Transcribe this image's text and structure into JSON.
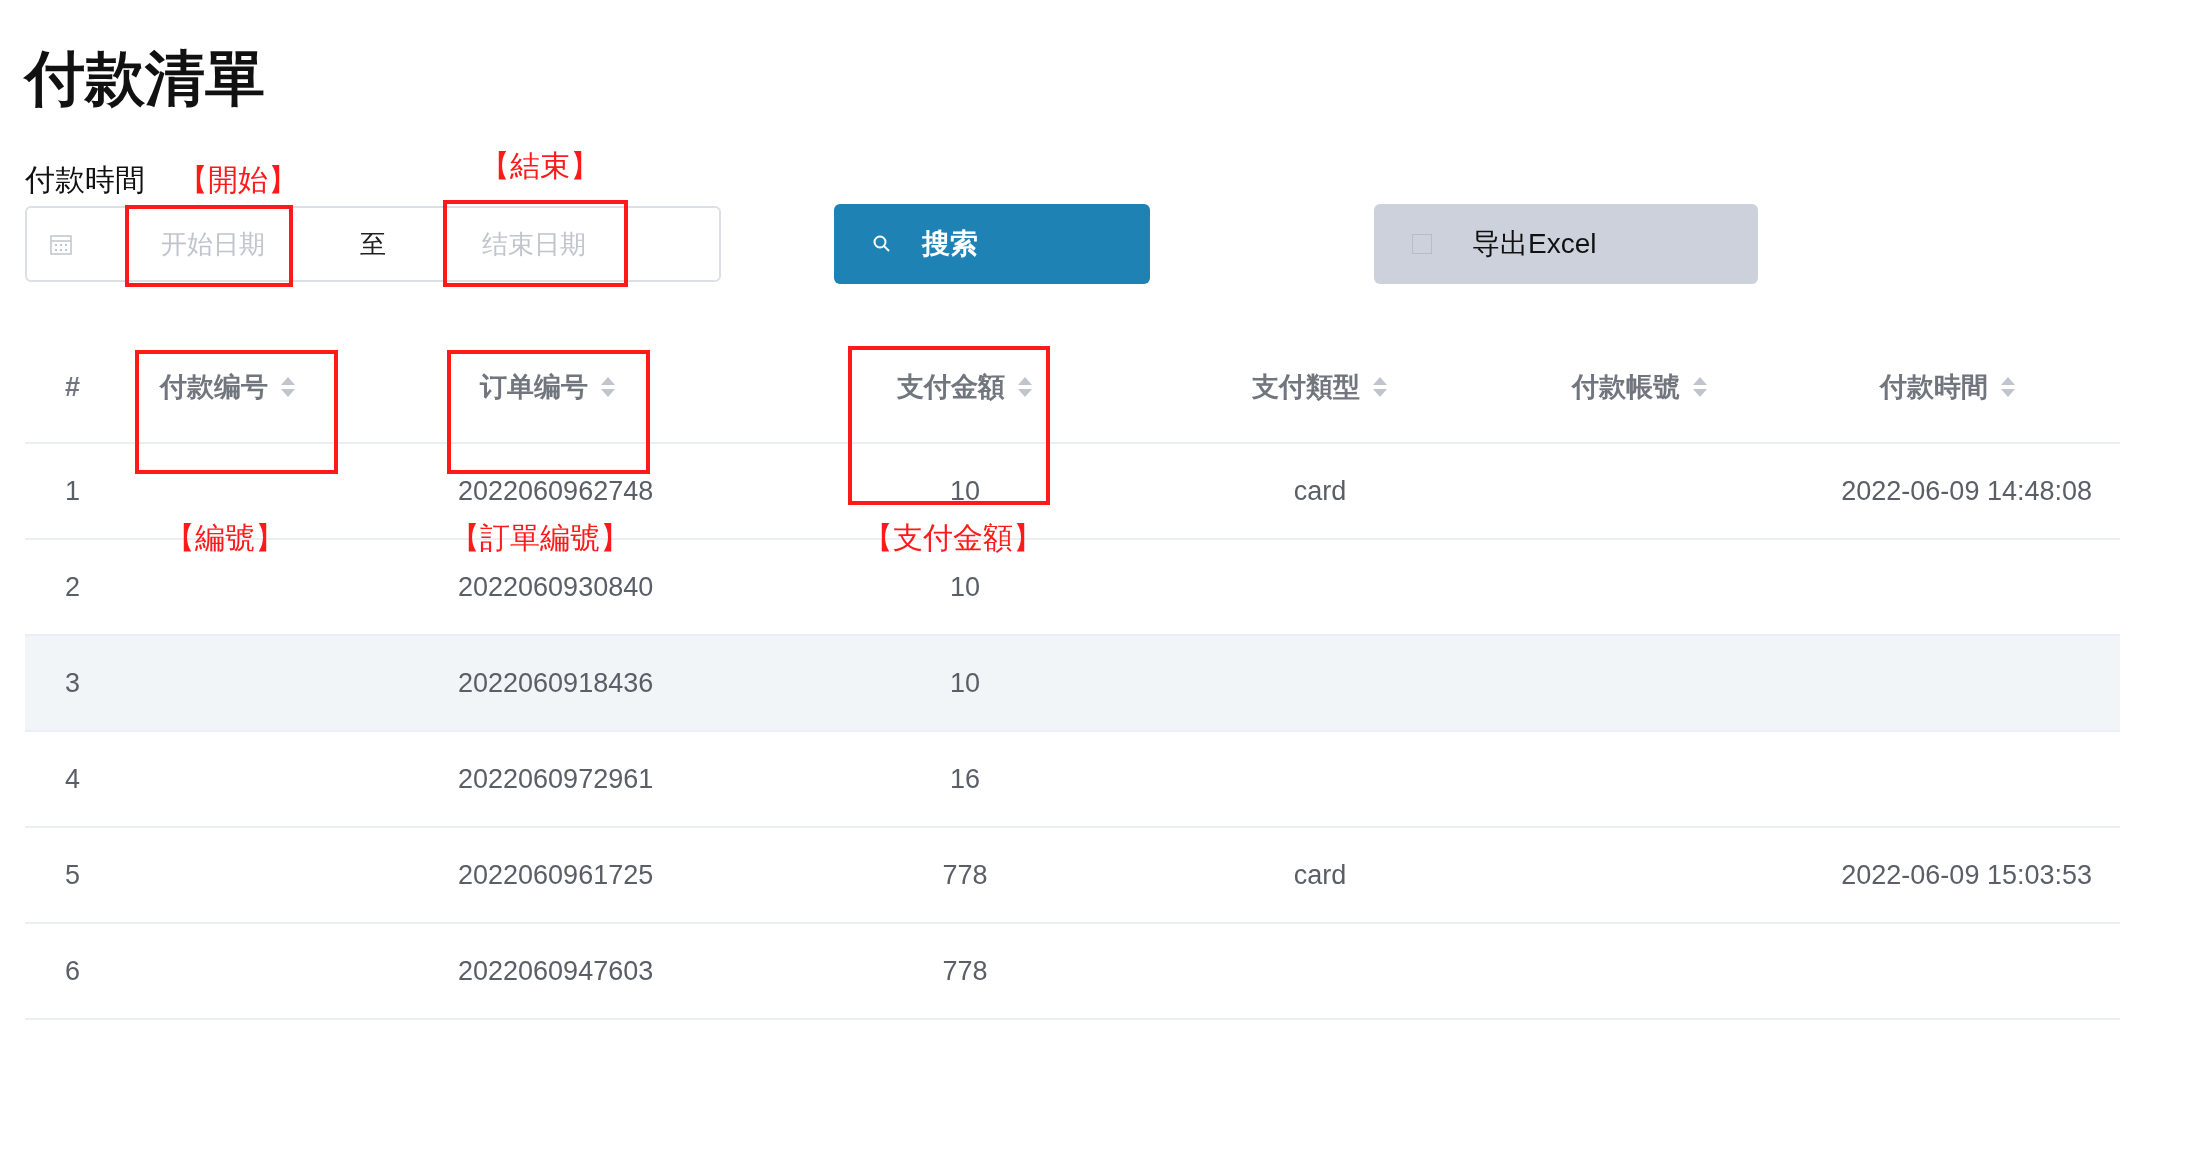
{
  "page": {
    "title": "付款清單"
  },
  "filter": {
    "label": "付款時間",
    "start_placeholder": "开始日期",
    "separator": "至",
    "end_placeholder": "结束日期"
  },
  "buttons": [
    {
      "kind": "primary",
      "label": "搜索"
    },
    {
      "kind": "secondary",
      "label": "导出Excel"
    }
  ],
  "table": {
    "columns": [
      {
        "label": "#",
        "sortable": false
      },
      {
        "label": "付款编号",
        "sortable": true
      },
      {
        "label": "订单编号",
        "sortable": true
      },
      {
        "label": "支付金額",
        "sortable": true
      },
      {
        "label": "支付類型",
        "sortable": true
      },
      {
        "label": "付款帳號",
        "sortable": true
      },
      {
        "label": "付款時間",
        "sortable": true
      }
    ],
    "rows": [
      {
        "highlighted": false,
        "cells": [
          "1",
          "",
          "2022060962748",
          "10",
          "card",
          "",
          "2022-06-09 14:48:08"
        ]
      },
      {
        "highlighted": false,
        "cells": [
          "2",
          "",
          "2022060930840",
          "10",
          "",
          "",
          ""
        ]
      },
      {
        "highlighted": true,
        "cells": [
          "3",
          "",
          "2022060918436",
          "10",
          "",
          "",
          ""
        ]
      },
      {
        "highlighted": false,
        "cells": [
          "4",
          "",
          "2022060972961",
          "16",
          "",
          "",
          ""
        ]
      },
      {
        "highlighted": false,
        "cells": [
          "5",
          "",
          "2022060961725",
          "778",
          "card",
          "",
          "2022-06-09 15:03:53"
        ]
      },
      {
        "highlighted": false,
        "cells": [
          "6",
          "",
          "2022060947603",
          "778",
          "",
          "",
          ""
        ]
      }
    ]
  },
  "annotations": [
    "【開始】",
    "【結束】",
    "【編號】",
    "【訂單編號】",
    "【支付金額】"
  ]
}
